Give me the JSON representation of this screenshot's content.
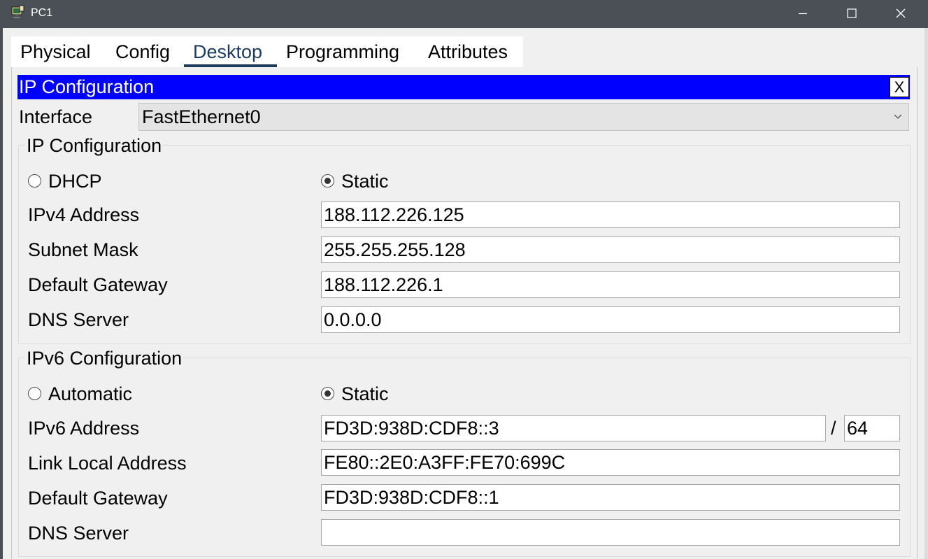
{
  "window": {
    "title": "PC1",
    "app_icon": "pc-icon",
    "controls": [
      "minimize-icon",
      "maximize-icon",
      "close-icon"
    ]
  },
  "tabs": [
    {
      "label": "Physical",
      "active": false
    },
    {
      "label": "Config",
      "active": false
    },
    {
      "label": "Desktop",
      "active": true
    },
    {
      "label": "Programming",
      "active": false
    },
    {
      "label": "Attributes",
      "active": false
    }
  ],
  "ip_config": {
    "header_title": "IP Configuration",
    "close_label": "X",
    "interface_label": "Interface",
    "interface_value": "FastEthernet0",
    "ipv4": {
      "group_title": "IP Configuration",
      "dhcp_label": "DHCP",
      "static_label": "Static",
      "mode": "Static",
      "address_label": "IPv4 Address",
      "address_value": "188.112.226.125",
      "mask_label": "Subnet Mask",
      "mask_value": "255.255.255.128",
      "gateway_label": "Default Gateway",
      "gateway_value": "188.112.226.1",
      "dns_label": "DNS Server",
      "dns_value": "0.0.0.0"
    },
    "ipv6": {
      "group_title": "IPv6 Configuration",
      "auto_label": "Automatic",
      "static_label": "Static",
      "mode": "Static",
      "address_label": "IPv6 Address",
      "address_value": "FD3D:938D:CDF8::3",
      "prefix_separator": "/",
      "prefix_value": "64",
      "link_local_label": "Link Local Address",
      "link_local_value": "FE80::2E0:A3FF:FE70:699C",
      "gateway_label": "Default Gateway",
      "gateway_value": "FD3D:938D:CDF8::1",
      "dns_label": "DNS Server",
      "dns_value": ""
    }
  },
  "colors": {
    "titlebar": "#4a5056",
    "header_blue": "#0000ff",
    "active_tab": "#1d3b5f"
  }
}
